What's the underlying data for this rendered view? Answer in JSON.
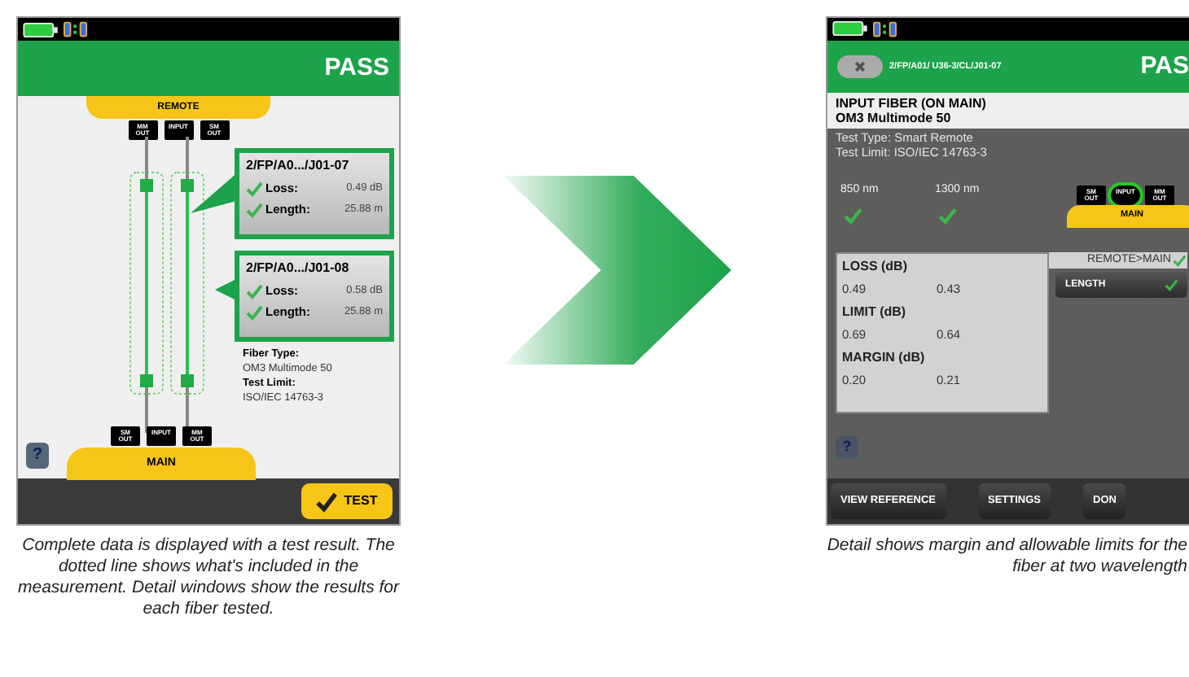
{
  "left_screen": {
    "result": "PASS",
    "remote": {
      "label": "REMOTE",
      "ports": [
        "MM OUT",
        "INPUT",
        "SM OUT"
      ]
    },
    "main": {
      "label": "MAIN",
      "ports": [
        "SM OUT",
        "INPUT",
        "MM OUT"
      ]
    },
    "fibers": [
      {
        "name": "2/FP/A0.../J01-07",
        "checks": [
          {
            "label": "Loss:",
            "value": "0.49 dB",
            "passed": true
          },
          {
            "label": "Length:",
            "value": "25.88 m",
            "passed": true
          }
        ]
      },
      {
        "name": "2/FP/A0.../J01-08",
        "checks": [
          {
            "label": "Loss:",
            "value": "0.58 dB",
            "passed": true
          },
          {
            "label": "Length:",
            "value": "25.88 m",
            "passed": true
          }
        ]
      }
    ],
    "info": [
      {
        "label": "Fiber Type:",
        "value": "OM3 Multimode 50"
      },
      {
        "label": "Test Limit:",
        "value": "ISO/IEC 14763-3"
      }
    ],
    "help": "?",
    "test_button": "TEST"
  },
  "right_screen": {
    "path": "2/FP/A01/ U36-3/CL/J01-07",
    "result": "PAS",
    "title_lines": [
      "INPUT FIBER (ON MAIN)",
      "OM3 Multimode 50"
    ],
    "details": [
      "Test Type: Smart Remote",
      "Test Limit: ISO/IEC 14763-3"
    ],
    "wavelengths": [
      {
        "label": "850 nm",
        "passed": true
      },
      {
        "label": "1300 nm",
        "passed": true
      }
    ],
    "main": {
      "label": "MAIN",
      "ports": [
        {
          "label": "SM OUT",
          "selected": false
        },
        {
          "label": "INPUT",
          "selected": true
        },
        {
          "label": "MM OUT",
          "selected": false
        }
      ]
    },
    "results": [
      {
        "heading": "LOSS (dB)",
        "values": [
          "0.49",
          "0.43"
        ]
      },
      {
        "heading": "LIMIT (dB)",
        "values": [
          "0.69",
          "0.64"
        ]
      },
      {
        "heading": "MARGIN (dB)",
        "values": [
          "0.20",
          "0.21"
        ]
      }
    ],
    "direction": {
      "label": "REMOTE>MAIN",
      "passed": true
    },
    "length_button": {
      "label": "LENGTH",
      "passed": true
    },
    "help": "?",
    "buttons": [
      "VIEW REFERENCE",
      "SETTINGS",
      "DON"
    ]
  },
  "captions": [
    "Complete data is displayed with a test result. The dotted line shows what's included in the measurement. Detail windows show the results for each fiber tested.",
    "Detail shows margin and allowable limits for the fiber at two wavelength"
  ]
}
